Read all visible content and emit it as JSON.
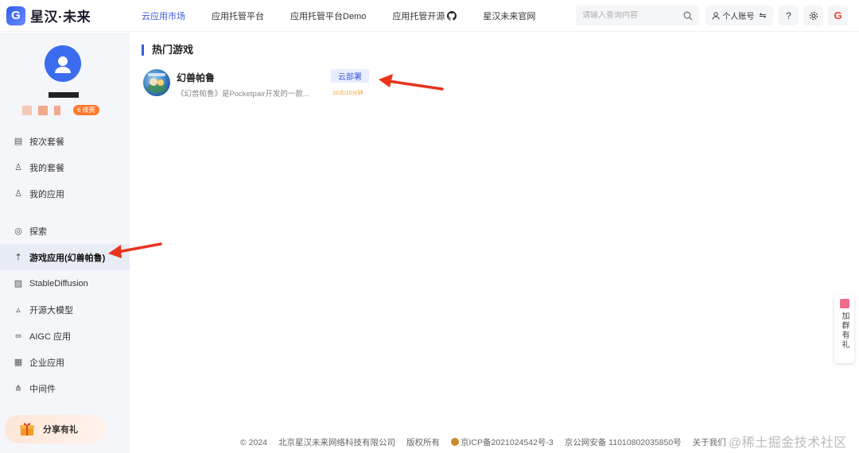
{
  "header": {
    "logo_text": "星汉·未来",
    "logo_mark": "G",
    "nav": [
      {
        "label": "云应用市场",
        "active": true
      },
      {
        "label": "应用托管平台"
      },
      {
        "label": "应用托管平台Demo"
      },
      {
        "label": "应用托管开源"
      },
      {
        "label": "星汉未来官网"
      }
    ],
    "search_placeholder": "请输入查询内容",
    "account_label": "个人账号",
    "help_label": "?",
    "accent_color": "#3b5bdb"
  },
  "sidebar": {
    "badge": "6 续费",
    "menu_group1": [
      {
        "label": "按次套餐",
        "icon": "receipt-icon"
      },
      {
        "label": "我的套餐",
        "icon": "user-icon"
      },
      {
        "label": "我的应用",
        "icon": "user-icon"
      }
    ],
    "menu_group2": [
      {
        "label": "探索",
        "icon": "compass-icon"
      },
      {
        "label": "游戏应用(幻兽帕鲁)",
        "icon": "rocket-icon",
        "active": true
      },
      {
        "label": "StableDiffusion",
        "icon": "image-icon"
      },
      {
        "label": "开源大模型",
        "icon": "model-icon"
      },
      {
        "label": "AIGC 应用",
        "icon": "link-icon"
      },
      {
        "label": "企业应用",
        "icon": "grid-icon"
      },
      {
        "label": "中间件",
        "icon": "nodes-icon"
      }
    ],
    "share_label": "分享有礼"
  },
  "main": {
    "section_title": "热门游戏",
    "game": {
      "name": "幻兽帕鲁",
      "desc": "《幻兽帕鲁》是Pocketpair开发的一款...",
      "deploy_label": "云部署",
      "price": "10点/10分钟"
    }
  },
  "float_tag": {
    "text": "加群有礼"
  },
  "footer": {
    "copyright": "© 2024",
    "company": "北京星汉未来网络科技有限公司",
    "rights": "版权所有",
    "icp": "京ICP备2021024542号-3",
    "police": "京公网安备 11010802035850号",
    "about": "关于我们"
  },
  "watermark": "@稀土掘金技术社区"
}
